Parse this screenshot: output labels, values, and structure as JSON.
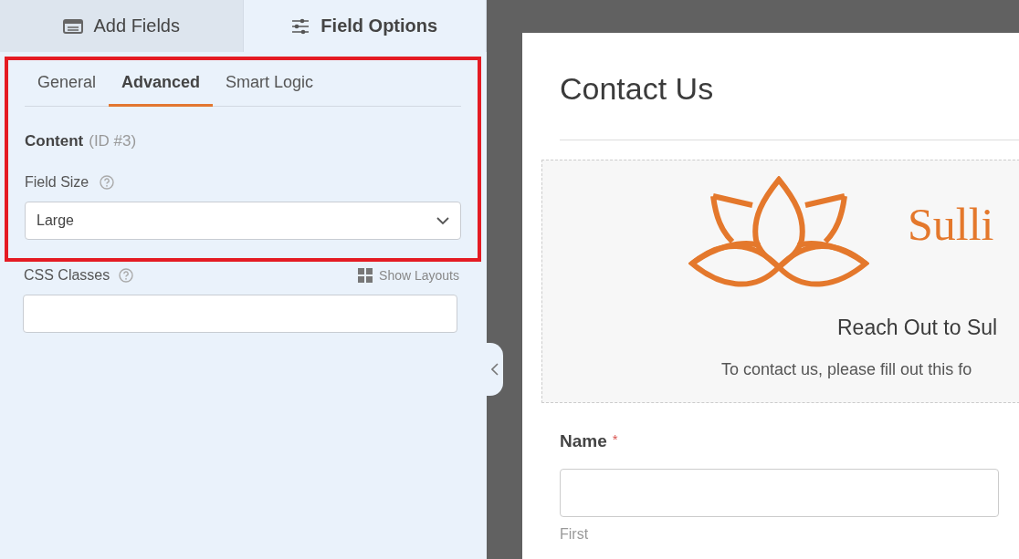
{
  "panel_tabs": [
    {
      "label": "Add Fields",
      "selected": false
    },
    {
      "label": "Field Options",
      "selected": true
    }
  ],
  "sub_tabs": [
    {
      "label": "General",
      "selected": false
    },
    {
      "label": "Advanced",
      "selected": true
    },
    {
      "label": "Smart Logic",
      "selected": false
    }
  ],
  "field": {
    "title": "Content",
    "id": "(ID #3)"
  },
  "field_size": {
    "label": "Field Size",
    "value": "Large"
  },
  "css_classes": {
    "label": "CSS Classes",
    "link": "Show Layouts"
  },
  "form": {
    "title": "Contact Us",
    "logo_text": "Sulli",
    "heading": "Reach Out to Sul",
    "description": "To contact us, please fill out this fo",
    "fields": [
      {
        "label": "Name",
        "required": true,
        "required_mark": "*",
        "sublabel": "First"
      }
    ]
  }
}
